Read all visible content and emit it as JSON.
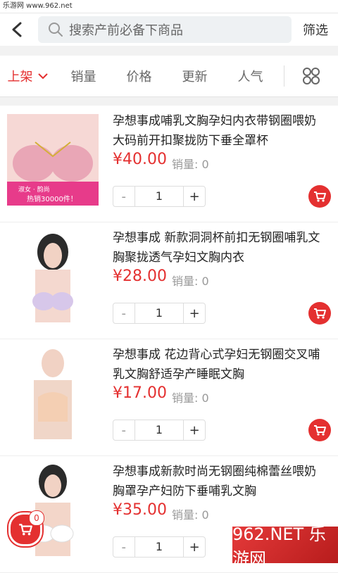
{
  "watermark": {
    "top": "乐游网 www.962.net",
    "bottom": "962.NET 乐游网"
  },
  "header": {
    "search": {
      "placeholder": "搜索产前必备下商品"
    },
    "filter_label": "筛选"
  },
  "sortbar": {
    "items": [
      "上架",
      "销量",
      "价格",
      "更新",
      "人气"
    ],
    "active_index": 0
  },
  "products": [
    {
      "title": "孕想事成哺乳文胸孕妇内衣带钢圈喂奶大码前开扣聚拢防下垂全罩杯",
      "price": "¥40.00",
      "sales_label": "销量: 0",
      "qty": "1",
      "image_caption_1": "淑女 · 韵尚",
      "image_caption_2": "热销30000件！"
    },
    {
      "title": "孕想事成 新款洞洞杯前扣无钢圈哺乳文胸聚拢透气孕妇文胸内衣",
      "price": "¥28.00",
      "sales_label": "销量: 0",
      "qty": "1"
    },
    {
      "title": "孕想事成 花边背心式孕妇无钢圈交叉哺乳文胸舒适孕产睡眠文胸",
      "price": "¥17.00",
      "sales_label": "销量: 0",
      "qty": "1"
    },
    {
      "title": "孕想事成新款时尚无钢圈纯棉蕾丝喂奶胸罩孕产妇防下垂哺乳文胸",
      "price": "¥35.00",
      "sales_label": "销量: 0",
      "qty": "1"
    }
  ],
  "cart": {
    "count": "0"
  },
  "colors": {
    "accent": "#e43030"
  }
}
